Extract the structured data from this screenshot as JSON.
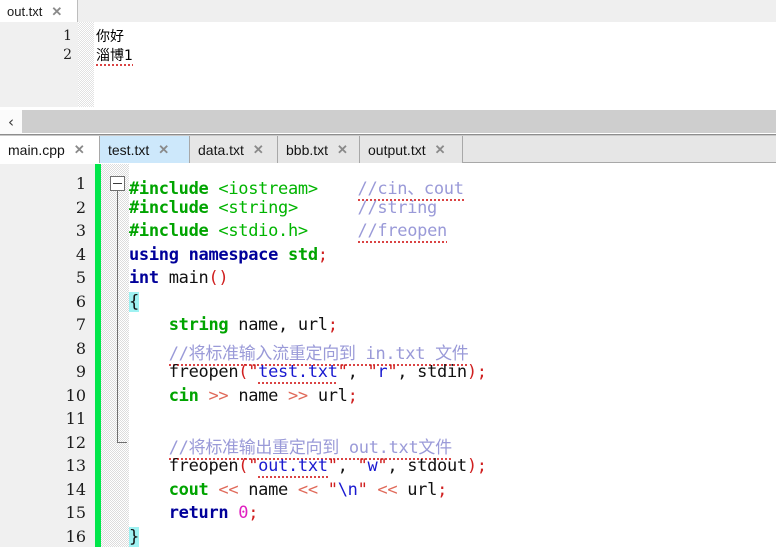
{
  "top_panel": {
    "tab": {
      "label": "out.txt",
      "close_glyph": "✕"
    },
    "line_numbers": [
      "1",
      "2"
    ],
    "lines": [
      {
        "text": "你好",
        "spell_error": false
      },
      {
        "text": "淄博1",
        "spell_error": true
      }
    ]
  },
  "navbar": {
    "prev_glyph": "‹"
  },
  "tabbar": {
    "close_glyph": "✕",
    "tabs": [
      {
        "label": "main.cpp",
        "state": "active"
      },
      {
        "label": "test.txt",
        "state": "hover"
      },
      {
        "label": "data.txt",
        "state": "plain"
      },
      {
        "label": "bbb.txt",
        "state": "plain"
      },
      {
        "label": "output.txt",
        "state": "plain"
      }
    ]
  },
  "editor": {
    "line_numbers": [
      "1",
      "2",
      "3",
      "4",
      "5",
      "6",
      "7",
      "8",
      "9",
      "10",
      "11",
      "12",
      "13",
      "14",
      "15",
      "16"
    ],
    "fold_marker_line": 6,
    "fold_end_line": 16,
    "change_bar_color": "#00e64a",
    "brace_highlight_color": "#9ff2f2",
    "code_lines": [
      {
        "n": 1,
        "tokens": [
          {
            "t": "#include ",
            "c": "k-pre"
          },
          {
            "t": "<iostream>",
            "c": "k-hdr"
          },
          {
            "t": "    ",
            "c": "k-plain"
          },
          {
            "t": "//cin、cout",
            "c": "k-cmt",
            "sq": true
          }
        ]
      },
      {
        "n": 2,
        "tokens": [
          {
            "t": "#include ",
            "c": "k-pre"
          },
          {
            "t": "<string>",
            "c": "k-hdr"
          },
          {
            "t": "      ",
            "c": "k-plain"
          },
          {
            "t": "//string",
            "c": "k-cmt",
            "sq": false
          }
        ]
      },
      {
        "n": 3,
        "tokens": [
          {
            "t": "#include ",
            "c": "k-pre"
          },
          {
            "t": "<stdio.h>",
            "c": "k-hdr"
          },
          {
            "t": "     ",
            "c": "k-plain"
          },
          {
            "t": "//freopen",
            "c": "k-cmt",
            "sq": true
          }
        ]
      },
      {
        "n": 4,
        "tokens": [
          {
            "t": "using namespace ",
            "c": "k-kw"
          },
          {
            "t": "std",
            "c": "k-id"
          },
          {
            "t": ";",
            "c": "k-punct"
          }
        ]
      },
      {
        "n": 5,
        "tokens": [
          {
            "t": "int ",
            "c": "k-kw"
          },
          {
            "t": "main",
            "c": "k-plain"
          },
          {
            "t": "()",
            "c": "k-punct"
          }
        ]
      },
      {
        "n": 6,
        "tokens": [
          {
            "t": "{",
            "c": "k-plain",
            "hl": true
          }
        ]
      },
      {
        "n": 7,
        "tokens": [
          {
            "t": "    ",
            "c": "k-plain"
          },
          {
            "t": "string",
            "c": "k-id"
          },
          {
            "t": " name, url",
            "c": "k-plain"
          },
          {
            "t": ";",
            "c": "k-punct"
          }
        ]
      },
      {
        "n": 8,
        "tokens": [
          {
            "t": "    ",
            "c": "k-plain"
          },
          {
            "t": "//将标准输入流重定向到 in.txt 文件",
            "c": "k-cmt",
            "sq": true
          }
        ]
      },
      {
        "n": 9,
        "tokens": [
          {
            "t": "    freopen",
            "c": "k-plain"
          },
          {
            "t": "(",
            "c": "k-punct"
          },
          {
            "t": "\"",
            "c": "k-quote"
          },
          {
            "t": "test.txt",
            "c": "k-str",
            "sq": true
          },
          {
            "t": "\"",
            "c": "k-quote"
          },
          {
            "t": ", ",
            "c": "k-plain"
          },
          {
            "t": "\"",
            "c": "k-quote"
          },
          {
            "t": "r",
            "c": "k-str"
          },
          {
            "t": "\"",
            "c": "k-quote"
          },
          {
            "t": ", stdin",
            "c": "k-plain"
          },
          {
            "t": ")",
            "c": "k-punct"
          },
          {
            "t": ";",
            "c": "k-punct"
          }
        ]
      },
      {
        "n": 10,
        "tokens": [
          {
            "t": "    ",
            "c": "k-plain"
          },
          {
            "t": "cin",
            "c": "k-id"
          },
          {
            "t": " >> ",
            "c": "k-op"
          },
          {
            "t": "name",
            "c": "k-plain"
          },
          {
            "t": " >> ",
            "c": "k-op"
          },
          {
            "t": "url",
            "c": "k-plain"
          },
          {
            "t": ";",
            "c": "k-punct"
          }
        ]
      },
      {
        "n": 11,
        "tokens": [
          {
            "t": "",
            "c": "k-plain"
          }
        ]
      },
      {
        "n": 12,
        "tokens": [
          {
            "t": "    ",
            "c": "k-plain"
          },
          {
            "t": "//将标准输出重定向到 out.txt文件",
            "c": "k-cmt",
            "sq": true
          }
        ]
      },
      {
        "n": 13,
        "tokens": [
          {
            "t": "    freopen",
            "c": "k-plain"
          },
          {
            "t": "(",
            "c": "k-punct"
          },
          {
            "t": "\"",
            "c": "k-quote"
          },
          {
            "t": "out.txt",
            "c": "k-str",
            "sq": true
          },
          {
            "t": "\"",
            "c": "k-quote"
          },
          {
            "t": ", ",
            "c": "k-plain"
          },
          {
            "t": "\"",
            "c": "k-quote"
          },
          {
            "t": "w",
            "c": "k-str"
          },
          {
            "t": "\"",
            "c": "k-quote"
          },
          {
            "t": ", stdout",
            "c": "k-plain"
          },
          {
            "t": ")",
            "c": "k-punct"
          },
          {
            "t": ";",
            "c": "k-punct"
          }
        ]
      },
      {
        "n": 14,
        "tokens": [
          {
            "t": "    ",
            "c": "k-plain"
          },
          {
            "t": "cout",
            "c": "k-id"
          },
          {
            "t": " << ",
            "c": "k-op"
          },
          {
            "t": "name",
            "c": "k-plain"
          },
          {
            "t": " << ",
            "c": "k-op"
          },
          {
            "t": "\"",
            "c": "k-quote"
          },
          {
            "t": "\\n",
            "c": "k-str"
          },
          {
            "t": "\"",
            "c": "k-quote"
          },
          {
            "t": " << ",
            "c": "k-op"
          },
          {
            "t": "url",
            "c": "k-plain"
          },
          {
            "t": ";",
            "c": "k-punct"
          }
        ]
      },
      {
        "n": 15,
        "tokens": [
          {
            "t": "    ",
            "c": "k-plain"
          },
          {
            "t": "return ",
            "c": "k-kw"
          },
          {
            "t": "0",
            "c": "k-num"
          },
          {
            "t": ";",
            "c": "k-punct"
          }
        ]
      },
      {
        "n": 16,
        "tokens": [
          {
            "t": "}",
            "c": "k-plain",
            "hl": true
          }
        ]
      }
    ]
  }
}
